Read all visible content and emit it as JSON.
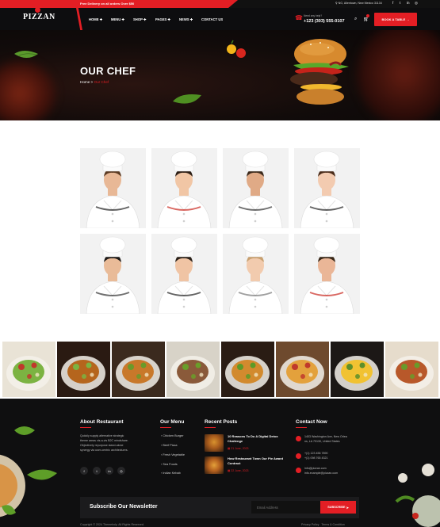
{
  "topbar": {
    "promo": "Free Delivery on all orders Over $50",
    "address": "NG, Allentown, New Mexico 31134",
    "social": [
      "f",
      "t",
      "in",
      "◎"
    ]
  },
  "header": {
    "logo": "PIZZAN",
    "nav": [
      "HOME",
      "MENU",
      "SHOP",
      "PAGES",
      "NEWS",
      "CONTACT US"
    ],
    "phone_label": "Need any help?",
    "phone": "+123 (303) 555-0107",
    "book_button": "BOOK A TABLE"
  },
  "banner": {
    "title": "OUR CHEF",
    "breadcrumb_home": "Home",
    "breadcrumb_sep": ">",
    "breadcrumb_current": "Our Chef"
  },
  "footer": {
    "about_heading": "About Restaurant",
    "about_text": [
      "Quickly supply alternative strategic",
      "theme areas vis-a-vis B2C mindshare.",
      "Objectively repurpose stand-alone",
      "synergy via user-centric architectures."
    ],
    "social": [
      "f",
      "t",
      "in",
      "◎"
    ],
    "menu_heading": "Our Menu",
    "menu_items": [
      "Chicken Burger",
      "Beef Pizza",
      "Fresh Vegetable",
      "Sea Foods",
      "Indian Kebab"
    ],
    "posts_heading": "Recent Posts",
    "posts": [
      {
        "title": "10 Reasons To Do A Digital Detox Challenge",
        "date": "21 June, 2023"
      },
      {
        "title": "How Restaurant Town Our Pie Award Contract",
        "date": "22 June, 2023"
      }
    ],
    "contact_heading": "Contact Now",
    "contact": [
      [
        "1403 Washington Ave, New Orlea",
        "ns, LA 70130, United States"
      ],
      [
        "+(1) 123 456 7890",
        "+(1) 098 765 4321"
      ],
      [
        "info@pizzan.com",
        "info.example@pizzan.com"
      ]
    ],
    "newsletter_title": "Subscribe Our Newsletter",
    "email_placeholder": "Email Address",
    "subscribe": "SUBSCRIBE",
    "copyright": "Copyright © 2024 Themeholy. All Rights Reserved.",
    "links": [
      "Privacy Policy",
      "Terms & Condition"
    ]
  },
  "colors": {
    "accent": "#e31e24",
    "dark": "#0f0f10"
  }
}
